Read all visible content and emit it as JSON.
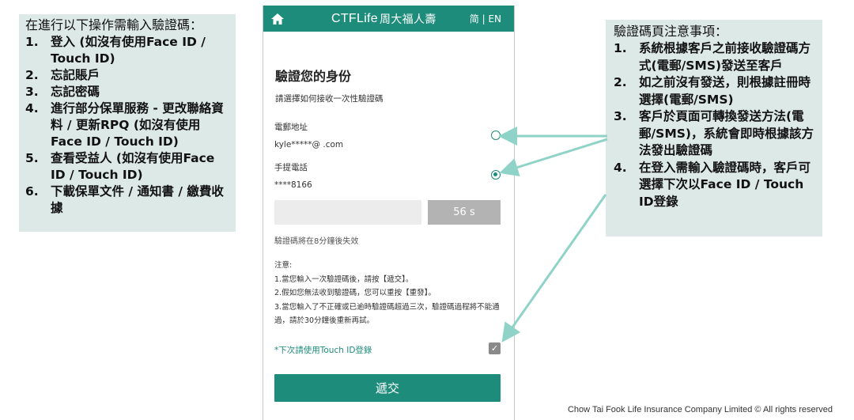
{
  "left_box": {
    "title": "在進行以下操作需輸入驗證碼：",
    "items": [
      {
        "num": "1.",
        "text": "登入 (如沒有使用Face ID / Touch ID)"
      },
      {
        "num": "2.",
        "text": "忘記賬戶"
      },
      {
        "num": "3.",
        "text": "忘記密碼"
      },
      {
        "num": "4.",
        "text": "進行部分保單服務 - 更改聯絡資料 / 更新RPQ (如沒有使用Face ID / Touch ID)"
      },
      {
        "num": "5.",
        "text": "查看受益人 (如沒有使用Face ID / Touch ID)"
      },
      {
        "num": "6.",
        "text": "下載保單文件 / 通知書 / 繳費收據"
      }
    ]
  },
  "right_box": {
    "title": "驗證碼頁注意事項：",
    "items": [
      {
        "num": "1.",
        "text": "系統根據客戶之前接收驗證碼方式(電郵/SMS)發送至客戶"
      },
      {
        "num": "2.",
        "text": "如之前沒有發送，則根據註冊時選擇(電郵/SMS)"
      },
      {
        "num": "3.",
        "text": "客戶於頁面可轉換發送方法(電郵/SMS)，系統會即時根據該方法發出驗證碼"
      },
      {
        "num": "4.",
        "text": "在登入需輸入驗證碼時，客戶可選擇下次以Face ID / Touch ID登錄"
      }
    ]
  },
  "phone": {
    "brand_en": "CTFLife",
    "brand_cn": "周大福人壽",
    "lang": "简 | EN",
    "page_title": "驗證您的身份",
    "subtitle": "請選擇如何接收一次性驗證碼",
    "email_label": "電郵地址",
    "email_value": "kyle*****@          .com",
    "email_selected": false,
    "phone_label": "手提電話",
    "phone_value": "****8166",
    "phone_selected": true,
    "code_placeholder": "",
    "resend_countdown": "56 s",
    "expire_note": "驗證碼將在8分鐘後失效",
    "notes_title": "注意:",
    "notes": [
      "1.當您輸入一次驗證碼後，請按【遞交】。",
      "2.假如您無法收到驗證碼，您可以重按【重發】。",
      "3.當您輸入了不正確或已逾時驗證碼超過三次，驗證碼過程將不能通過，請於30分鐘後重新再試。"
    ],
    "touch_id_label": "*下次請使用Touch ID登錄",
    "touch_id_checked": true,
    "submit_label": "遞交"
  },
  "copyright": "Chow Tai Fook Life Insurance Company Limited © All rights reserved",
  "colors": {
    "brand_green": "#1e8c7b",
    "info_box_bg": "#dde9e7",
    "arrow": "#8fd3c8",
    "disabled_button": "#b3b3b3"
  }
}
